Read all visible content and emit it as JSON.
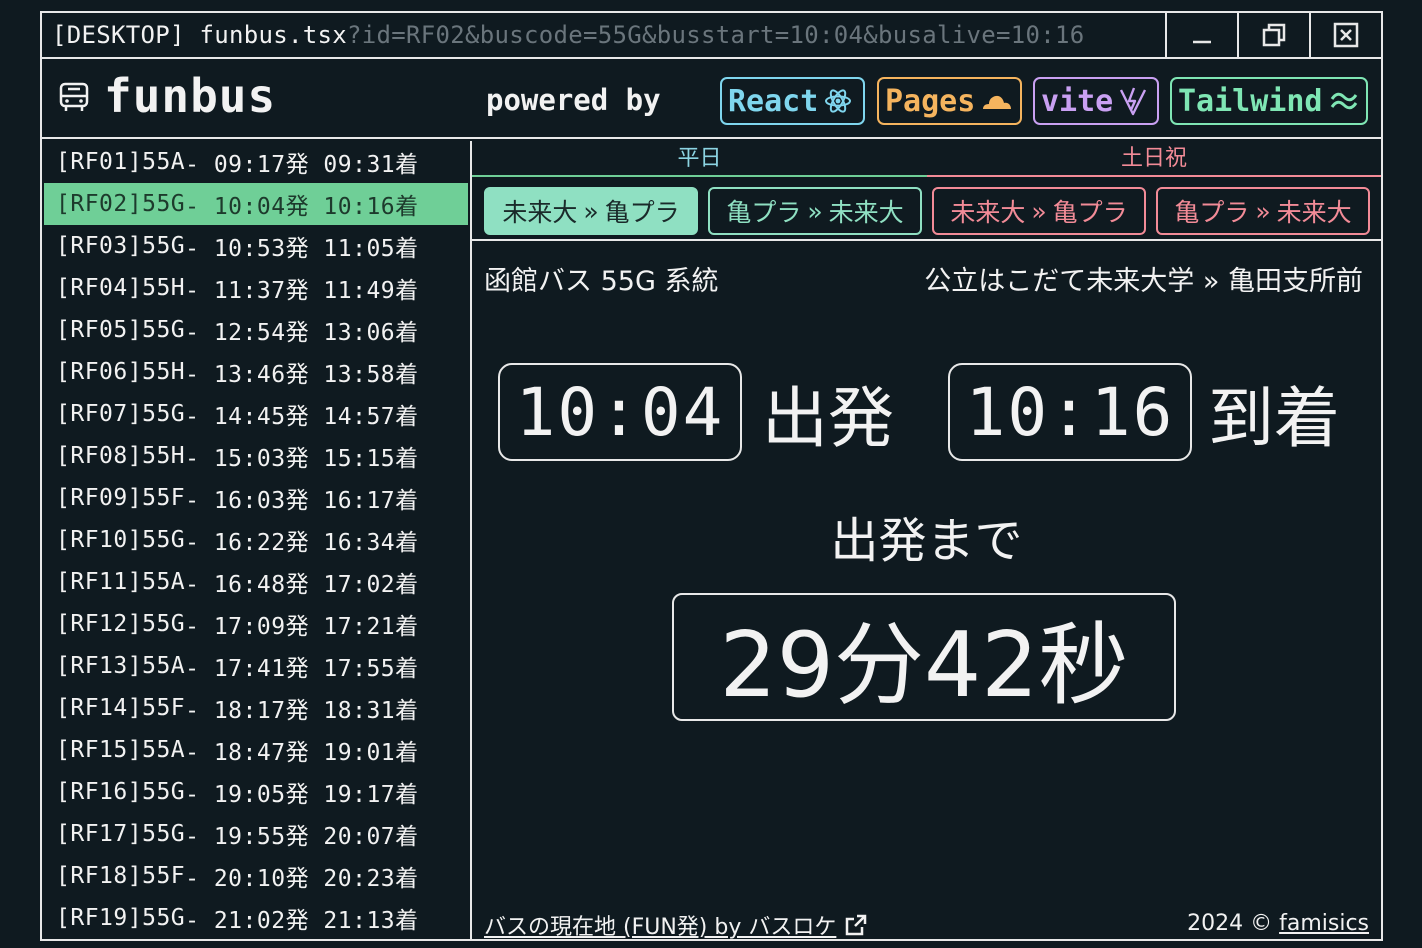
{
  "window": {
    "title_file": "[DESKTOP] funbus.tsx",
    "title_query": "?id=RF02&buscode=55G&busstart=10:04&busalive=10:16"
  },
  "header": {
    "app_name": "funbus",
    "powered_by": "powered by",
    "badges": [
      {
        "label": "React",
        "icon": "react-icon",
        "color": "#7fd6ee"
      },
      {
        "label": "Pages",
        "icon": "cloud-icon",
        "color": "#f5b45e"
      },
      {
        "label": "vite",
        "icon": "lightning-icon",
        "color": "#c9a0f2"
      },
      {
        "label": "Tailwind",
        "icon": "wave-icon",
        "color": "#7fe6b4"
      }
    ]
  },
  "schedule": [
    {
      "id": "[RF01]",
      "code": "55A",
      "text": "- 09:17発 09:31着"
    },
    {
      "id": "[RF02]",
      "code": "55G",
      "text": "- 10:04発 10:16着"
    },
    {
      "id": "[RF03]",
      "code": "55G",
      "text": "- 10:53発 11:05着"
    },
    {
      "id": "[RF04]",
      "code": "55H",
      "text": "- 11:37発 11:49着"
    },
    {
      "id": "[RF05]",
      "code": "55G",
      "text": "- 12:54発 13:06着"
    },
    {
      "id": "[RF06]",
      "code": "55H",
      "text": "- 13:46発 13:58着"
    },
    {
      "id": "[RF07]",
      "code": "55G",
      "text": "- 14:45発 14:57着"
    },
    {
      "id": "[RF08]",
      "code": "55H",
      "text": "- 15:03発 15:15着"
    },
    {
      "id": "[RF09]",
      "code": "55F",
      "text": "- 16:03発 16:17着"
    },
    {
      "id": "[RF10]",
      "code": "55G",
      "text": "- 16:22発 16:34着"
    },
    {
      "id": "[RF11]",
      "code": "55A",
      "text": "- 16:48発 17:02着"
    },
    {
      "id": "[RF12]",
      "code": "55G",
      "text": "- 17:09発 17:21着"
    },
    {
      "id": "[RF13]",
      "code": "55A",
      "text": "- 17:41発 17:55着"
    },
    {
      "id": "[RF14]",
      "code": "55F",
      "text": "- 18:17発 18:31着"
    },
    {
      "id": "[RF15]",
      "code": "55A",
      "text": "- 18:47発 19:01着"
    },
    {
      "id": "[RF16]",
      "code": "55G",
      "text": "- 19:05発 19:17着"
    },
    {
      "id": "[RF17]",
      "code": "55G",
      "text": "- 19:55発 20:07着"
    },
    {
      "id": "[RF18]",
      "code": "55F",
      "text": "- 20:10発 20:23着"
    },
    {
      "id": "[RF19]",
      "code": "55G",
      "text": "- 21:02発 21:13着"
    }
  ],
  "selected_row": "[RF02]",
  "days": {
    "weekday": "平日",
    "weekend": "土日祝"
  },
  "routes": [
    {
      "from": "未来大",
      "to": "亀プラ",
      "selected": true
    },
    {
      "from": "亀プラ",
      "to": "未来大",
      "selected": false
    },
    {
      "from": "未来大",
      "to": "亀プラ",
      "selected": false
    },
    {
      "from": "亀プラ",
      "to": "未来大",
      "selected": false
    }
  ],
  "detail": {
    "bus_line": "函館バス 55G 系統",
    "origin": "公立はこだて未来大学",
    "destination": "亀田支所前",
    "departure_time": "10:04",
    "departure_label": "出発",
    "arrival_time": "10:16",
    "arrival_label": "到着",
    "until_label": "出発まで",
    "countdown": "29分42秒"
  },
  "footer": {
    "link_text": "バスの現在地 (FUN発) by バスロケ",
    "copyright": "2024 ©",
    "author": "famisics"
  },
  "colors": {
    "accent_green": "#6fcf97",
    "weekday": "#8cd4e2",
    "weekend": "#f28b97",
    "background": "#0f1a20"
  }
}
